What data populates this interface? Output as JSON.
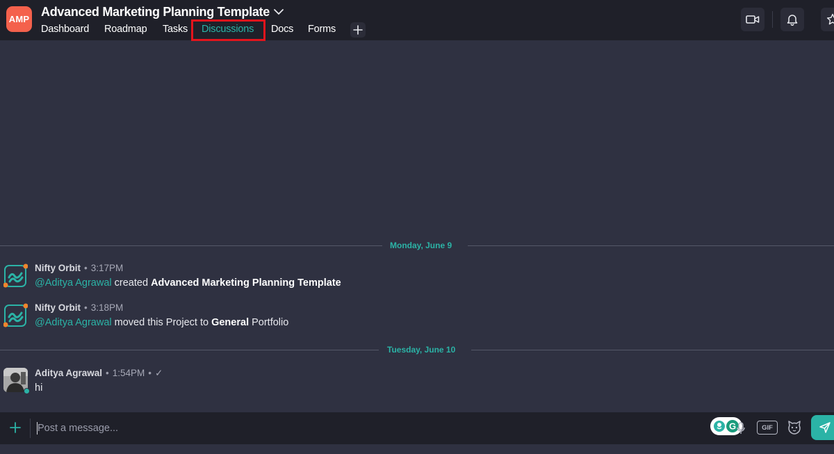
{
  "project": {
    "logo_text": "AMP",
    "title": "Advanced Marketing Planning Template"
  },
  "tabs": [
    {
      "label": "Dashboard"
    },
    {
      "label": "Roadmap"
    },
    {
      "label": "Tasks"
    },
    {
      "label": "Discussions",
      "active": true
    },
    {
      "label": "Docs"
    },
    {
      "label": "Forms"
    }
  ],
  "header_actions": [
    "video-call-icon",
    "bell-icon",
    "star-icon"
  ],
  "date_separators": [
    "Monday, June 9",
    "Tuesday, June 10"
  ],
  "messages": [
    {
      "author": "Nifty Orbit",
      "time": "3:17PM",
      "mention": "@Aditya Agrawal",
      "parts": [
        " created ",
        "Advanced Marketing Planning Template"
      ]
    },
    {
      "author": "Nifty Orbit",
      "time": "3:18PM",
      "mention": "@Aditya Agrawal",
      "parts": [
        " moved this Project to ",
        "General",
        " Portfolio"
      ]
    },
    {
      "author": "Aditya Agrawal",
      "time": "1:54PM",
      "status": "✓",
      "text": "hi"
    }
  ],
  "composer": {
    "placeholder": "Post a message...",
    "gif_label": "GIF"
  },
  "colors": {
    "accent": "#2bb3a6",
    "logo": "#f4614c",
    "background": "#2f3141",
    "header": "#1f2029",
    "highlight_box": "#e3141c"
  }
}
